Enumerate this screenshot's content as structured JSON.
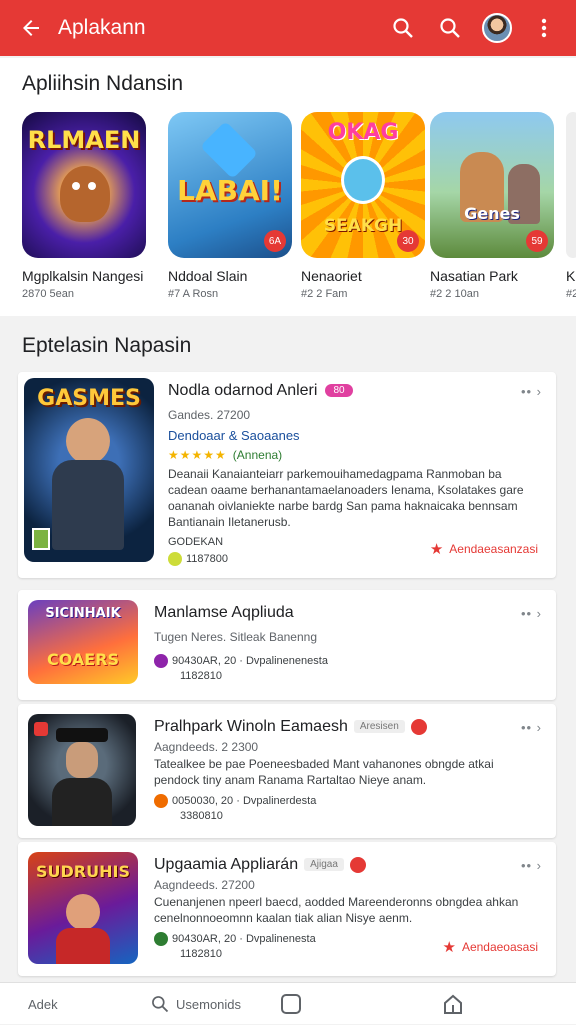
{
  "appbar": {
    "title": "Aplakann",
    "color": "#e53935",
    "icons": [
      "back-arrow-icon",
      "search-icon",
      "search-icon",
      "avatar",
      "more-vert-icon"
    ]
  },
  "featured": {
    "title": "Apliihsin Ndansin",
    "tiles": [
      {
        "art_text": "RLMAEN",
        "name": "Mgplkalsin Nangesi",
        "meta": "2870 5ean"
      },
      {
        "art_text": "LABAI!",
        "badge": "6A",
        "name": "Nddoal Slain",
        "meta": "#7 A Rosn"
      },
      {
        "art_text_top": "OKAG",
        "art_text_bottom": "SEAKGH",
        "badge": "30",
        "name": "Nenaoriet",
        "meta": "#2 2 Fam"
      },
      {
        "art_text": "Genes",
        "badge": "59",
        "name": "Nasatian Park",
        "meta": "#2 2 10an"
      },
      {
        "name": "K",
        "meta": "#2"
      }
    ]
  },
  "list": {
    "title": "Eptelasin Napasin",
    "items": [
      {
        "art_text": "GASMES",
        "title": "Nodla odarnod Anleri",
        "pill": "80",
        "subtitle": "Gandes. 27200",
        "category": "Dendoaar & Saoaanes",
        "stars": "★★★★★",
        "rating_note": "(Annena)",
        "description": "Deanaii Kanaianteiarr parkemouihamedagpama Ranmoban ba cadean oaame berhanantamaelanoaders Ienama, Ksolatakes gare oananah oivlaniekte narbe bardg San pama haknaicaka bennsam Bantianain Iletanerusb.",
        "foot1": "GODEKAN",
        "foot2": "1187800",
        "rec": "Aendaeasanzasi"
      },
      {
        "art_top": "SICINHAIK",
        "art_bottom": "COAERS",
        "title": "Manlamse Aqpliuda",
        "subtitle": "Tugen Neres. Sitleak Banenng",
        "foot1": "90430AR, 20 · Dvpalinenenesta",
        "foot2": "1182810"
      },
      {
        "title": "Pralhpark Winoln Eamaesh",
        "tag": "Aresisen",
        "subtitle": "Aagndeeds. 2 2300",
        "description": "Tatealkee be pae Poeneesbaded Mant vahanones obngde atkai pendock tiny anam Ranama Rartaltao Nieye anam.",
        "foot1": "0050030, 20 · Dvpalinerdesta",
        "foot2": "3380810"
      },
      {
        "art_text": "SUDRUHIS",
        "title": "Upgaamia Appliarán",
        "tag": "Ajigaa",
        "subtitle": "Aagndeeds. 27200",
        "description": "Cuenanjenen npeerl baecd, aodded Mareenderonns obngdea ahkan cenelnonnoeomnn kaalan tiak alian Nisye aenm.",
        "foot1": "90430AR, 20 · Dvpalinenesta",
        "foot2": "1182810",
        "rec": "Aendaeoasasi"
      }
    ]
  },
  "bottom_nav": {
    "left": "Adek",
    "search": "Usemonids"
  }
}
